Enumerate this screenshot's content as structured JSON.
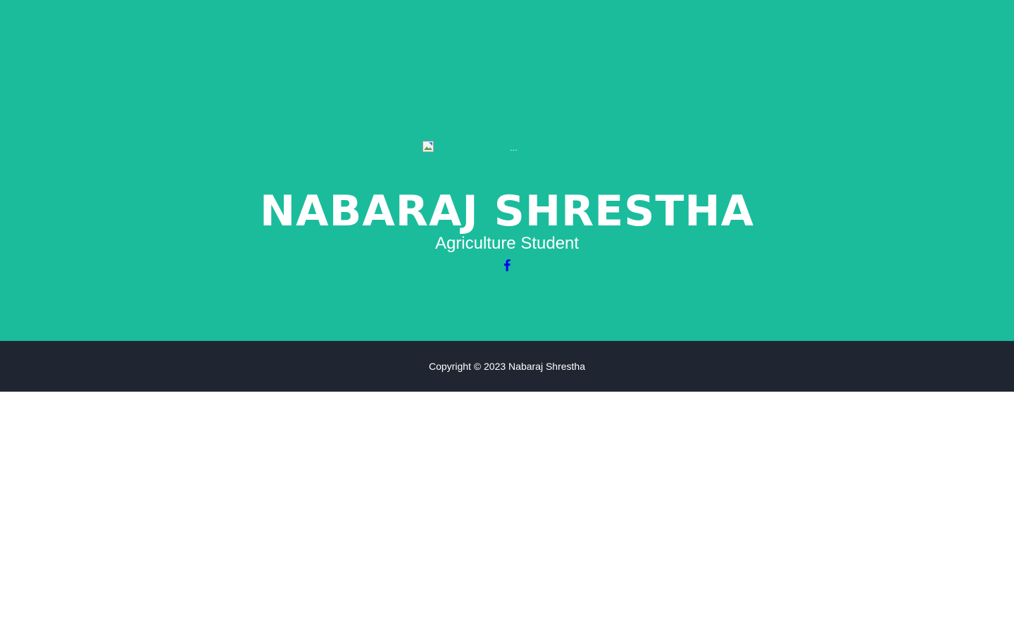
{
  "hero": {
    "avatar_alt": "...",
    "name": "NABARAJ SHRESTHA",
    "subtitle": "Agriculture Student",
    "social": [
      {
        "icon": "facebook-icon",
        "color": "#0000ee"
      }
    ],
    "background_color": "#1abc9c"
  },
  "footer": {
    "copyright": "Copyright © 2023 Nabaraj Shrestha",
    "background_color": "#1f2631"
  }
}
